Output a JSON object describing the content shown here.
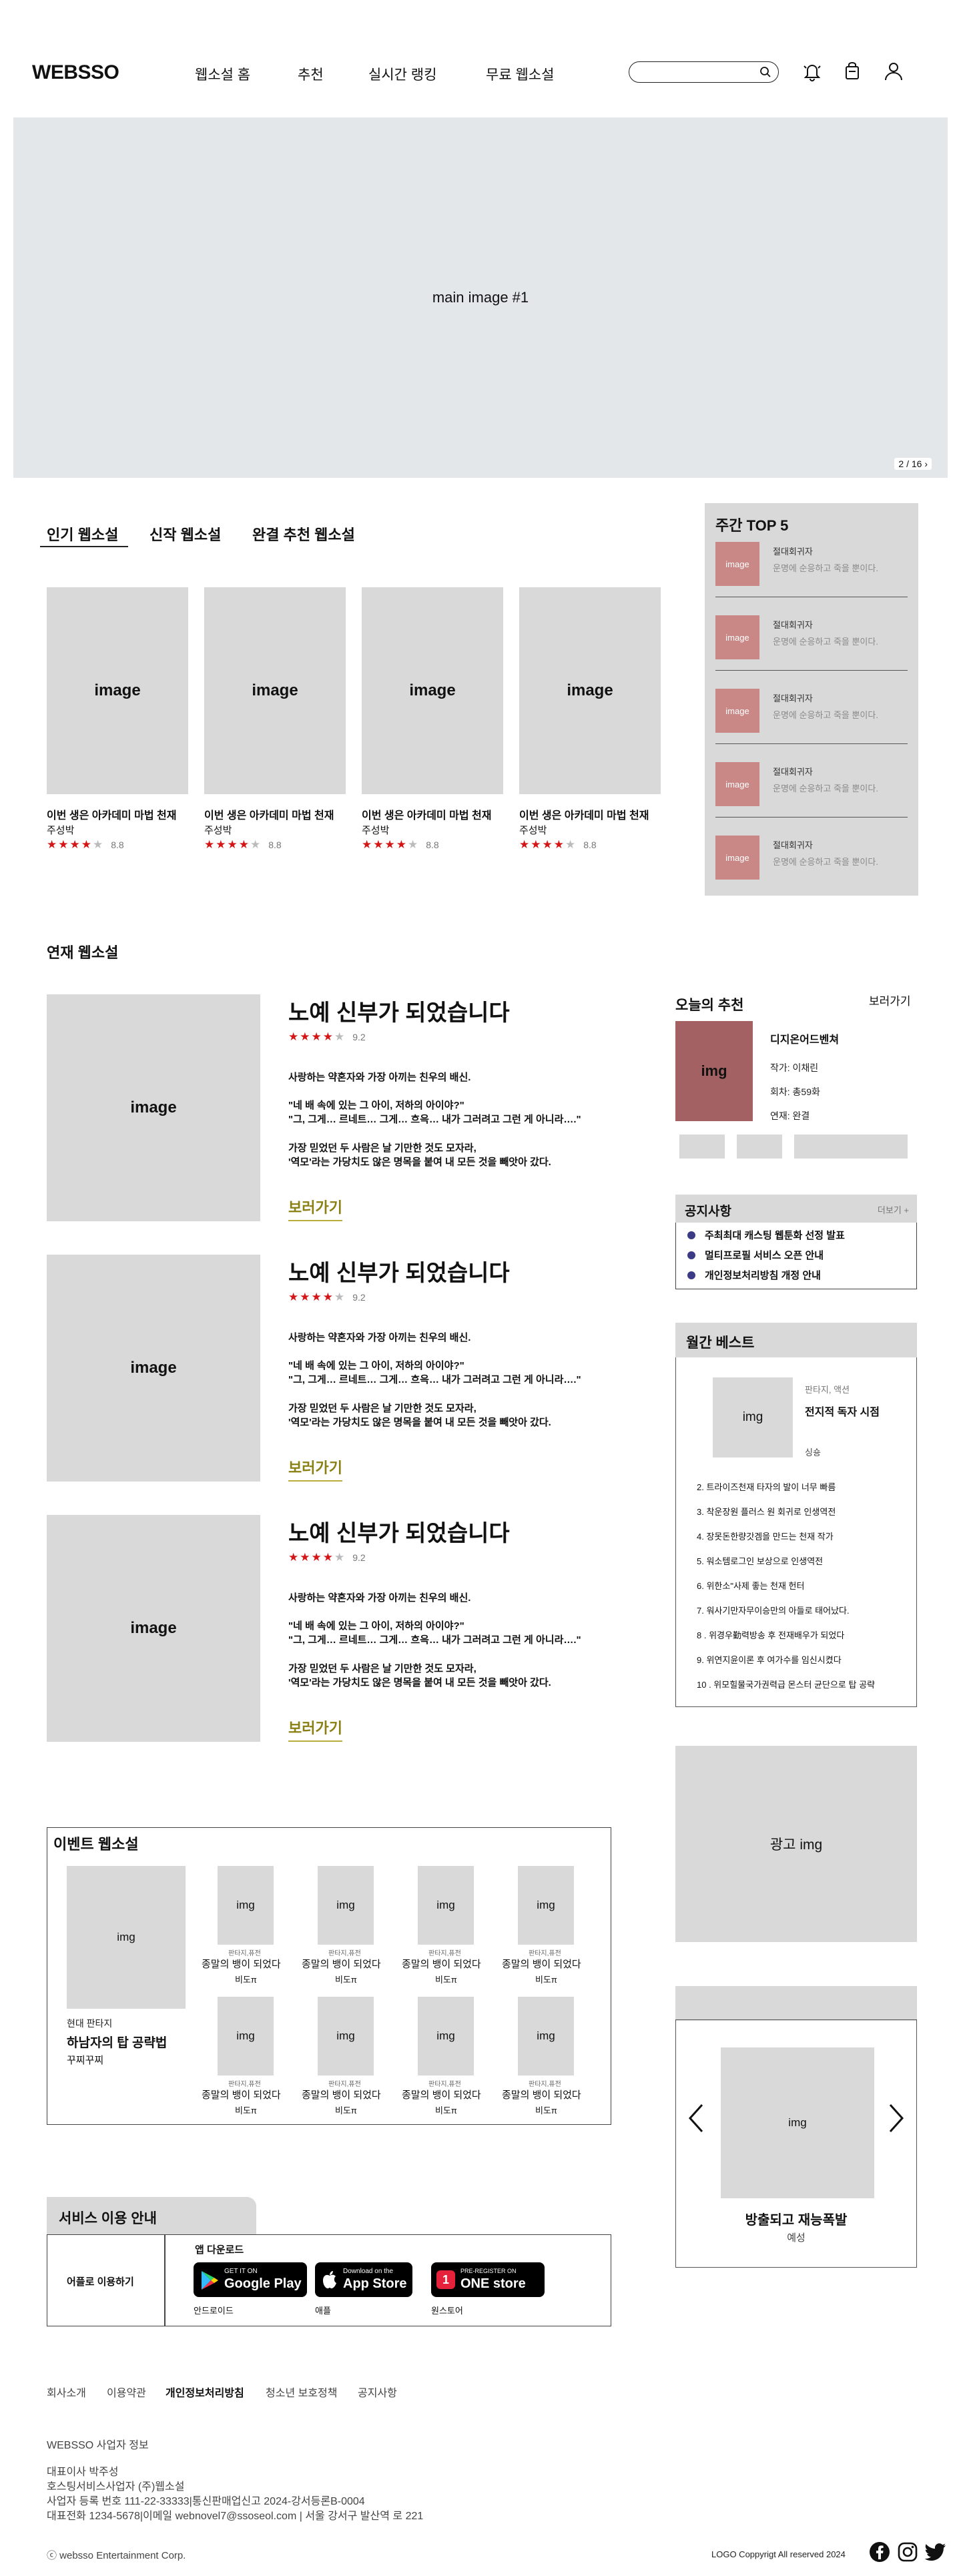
{
  "header": {
    "logo": "WEBSSO",
    "nav": [
      "웹소설 홈",
      "추천",
      "실시간 랭킹",
      "무료 웹소설"
    ],
    "search_placeholder": ""
  },
  "hero": {
    "label": "main image #1",
    "pager": "2 / 16"
  },
  "popular": {
    "tabs": [
      "인기 웹소설",
      "신작 웹소설",
      "완결 추천 웹소설"
    ],
    "active_tab": 0,
    "cards": [
      {
        "image": "image",
        "title": "이번 생은 아카데미 마법 천재",
        "author": "주성박",
        "rating": "8.8",
        "stars": 4
      },
      {
        "image": "image",
        "title": "이번 생은 아카데미 마법 천재",
        "author": "주성박",
        "rating": "8.8",
        "stars": 4
      },
      {
        "image": "image",
        "title": "이번 생은 아카데미 마법 천재",
        "author": "주성박",
        "rating": "8.8",
        "stars": 4
      },
      {
        "image": "image",
        "title": "이번 생은 아카데미 마법 천재",
        "author": "주성박",
        "rating": "8.8",
        "stars": 4
      }
    ]
  },
  "weekly_top5": {
    "title": "주간 TOP  5",
    "items": [
      {
        "image": "image",
        "name": "절대회귀자",
        "desc": "운명에 순응하고 죽을 뿐이다."
      },
      {
        "image": "image",
        "name": "절대회귀자",
        "desc": "운명에 순응하고 죽을 뿐이다."
      },
      {
        "image": "image",
        "name": "절대회귀자",
        "desc": "운명에 순응하고 죽을 뿐이다."
      },
      {
        "image": "image",
        "name": "절대회귀자",
        "desc": "운명에 순응하고 죽을 뿐이다."
      },
      {
        "image": "image",
        "name": "절대회귀자",
        "desc": "운명에 순응하고 죽을 뿐이다."
      }
    ]
  },
  "serial": {
    "title": "연재 웹소설",
    "items": [
      {
        "image": "image",
        "title": "노예 신부가 되었습니다",
        "rating": "9.2",
        "stars": 4,
        "p1": "사랑하는 약혼자와 가장 아끼는 친우의 배신.",
        "p2": "\"네 배 속에 있는 그 아이, 저하의 아이야?\"\n\"그, 그게… 르네트… 그게… 흐윽… 내가 그러려고 그런 게 아니라….\"",
        "p3": "가장 믿었던 두 사람은 날 기만한 것도 모자라,\n'역모'라는 가당치도 않은 명목을 붙여 내 모든 것을 빼앗아 갔다.",
        "link": "보러가기"
      },
      {
        "image": "image",
        "title": "노예 신부가 되었습니다",
        "rating": "9.2",
        "stars": 4,
        "p1": "사랑하는 약혼자와 가장 아끼는 친우의 배신.",
        "p2": "\"네 배 속에 있는 그 아이, 저하의 아이야?\"\n\"그, 그게… 르네트… 그게… 흐윽… 내가 그러려고 그런 게 아니라….\"",
        "p3": "가장 믿었던 두 사람은 날 기만한 것도 모자라,\n'역모'라는 가당치도 않은 명목을 붙여 내 모든 것을 빼앗아 갔다.",
        "link": "보러가기"
      },
      {
        "image": "image",
        "title": "노예 신부가 되었습니다",
        "rating": "9.2",
        "stars": 4,
        "p1": "사랑하는 약혼자와 가장 아끼는 친우의 배신.",
        "p2": "\"네 배 속에 있는 그 아이, 저하의 아이야?\"\n\"그, 그게… 르네트… 그게… 흐윽… 내가 그러려고 그런 게 아니라….\"",
        "p3": "가장 믿었던 두 사람은 날 기만한 것도 모자라,\n'역모'라는 가당치도 않은 명목을 붙여 내 모든 것을 빼앗아 갔다.",
        "link": "보러가기"
      }
    ]
  },
  "today": {
    "title": "오늘의 추천",
    "more": "보러가기",
    "image": "img",
    "name": "디지온어드벤쳐",
    "author": "작가: 이채린",
    "episodes": "회차: 총59화",
    "status": "연재: 완결"
  },
  "notice": {
    "title": "공지사항",
    "more": "더보기 +",
    "items": [
      "주최최대 캐스팅 웹툰화 선정 발표",
      "멀티프로필 서비스 오픈 안내",
      "개인정보처리방침 개정 안내"
    ]
  },
  "monthly_best": {
    "title": "월간 베스트",
    "top": {
      "image": "img",
      "genre": "판타지, 액션",
      "title": "전지적 독자 시점",
      "author": "싱숑"
    },
    "items": [
      "2. 트라이즈천재 타자의 발이 너무 빠름",
      "3. 착운장원 플러스 원 회귀로 인생역전",
      "4. 장못돈한량갓겜을 만드는 천재 작가",
      "5. 워소템로그인 보상으로 인생역전",
      "6. 위한소\"사제 좋는 천재 헌터",
      "7. 워사기만자무이승만의 아들로 태어났다.",
      "8 . 위경우勤력방송 후 전재배우가 되었다",
      "9. 위연지윤이론 후 여가수를 임신시켰다",
      "10 . 위모힐물국가권력급 몬스터 균단으로 탑 공략"
    ]
  },
  "ad": {
    "label": "광고 img"
  },
  "carousel": {
    "image": "img",
    "title": "방출되고 재능폭발",
    "author": "예성"
  },
  "event": {
    "title": "이벤트 웹소설",
    "main": {
      "image": "img",
      "genre": "현대 판타지",
      "title": "하남자의 탑 공략법",
      "author": "꾸찌꾸찌"
    },
    "items": [
      {
        "image": "img",
        "genre": "판타지,퓨전",
        "title": "종말의 뱅이 되었다",
        "author": "비도π"
      },
      {
        "image": "img",
        "genre": "판타지,퓨전",
        "title": "종말의 뱅이 되었다",
        "author": "비도π"
      },
      {
        "image": "img",
        "genre": "판타지,퓨전",
        "title": "종말의 뱅이 되었다",
        "author": "비도π"
      },
      {
        "image": "img",
        "genre": "판타지,퓨전",
        "title": "종말의 뱅이 되었다",
        "author": "비도π"
      },
      {
        "image": "img",
        "genre": "판타지,퓨전",
        "title": "종말의 뱅이 되었다",
        "author": "비도π"
      },
      {
        "image": "img",
        "genre": "판타지,퓨전",
        "title": "종말의 뱅이 되었다",
        "author": "비도π"
      },
      {
        "image": "img",
        "genre": "판타지,퓨전",
        "title": "종말의 뱅이 되었다",
        "author": "비도π"
      },
      {
        "image": "img",
        "genre": "판타지,퓨전",
        "title": "종말의 뱅이 되었다",
        "author": "비도π"
      }
    ]
  },
  "service": {
    "title": "서비스 이용 안내",
    "label": "어플로 이용하기",
    "app_title": "앱 다운로드",
    "stores": [
      {
        "small": "GET IT ON",
        "big": "Google Play",
        "caption": "안드로이드"
      },
      {
        "small": "Download on the",
        "big": "App Store",
        "caption": "애플"
      },
      {
        "small": "PRE-REGISTER ON",
        "big": "ONE store",
        "caption": "원스토어"
      }
    ]
  },
  "footer": {
    "links": [
      "회사소개",
      "이용약관",
      "개인정보처리방침",
      "청소년 보호정책",
      "공지사항"
    ],
    "info_title": "WEBSSO 사업자 정보",
    "info_lines": [
      "대표이사 박주성",
      "호스팅서비스사업자 (주)웹소설",
      "사업자 등록 번호 111-22-33333|통신판매업신고 2024-강서등론B-0004",
      "대표전화 1234-5678|이메일 webnovel7@ssoseol.com | 서울 강서구 발산역 로 221"
    ],
    "copyright": "ⓒ websso Entertainment Corp.",
    "rights": "LOGO Coppyrigt All reserved 2024"
  },
  "colors": {
    "star": "#d51515",
    "thumb_pink": "#c98886",
    "today_img": "#a36163",
    "link_olive": "#8a7f13",
    "notice_dot": "#3b3a84"
  }
}
